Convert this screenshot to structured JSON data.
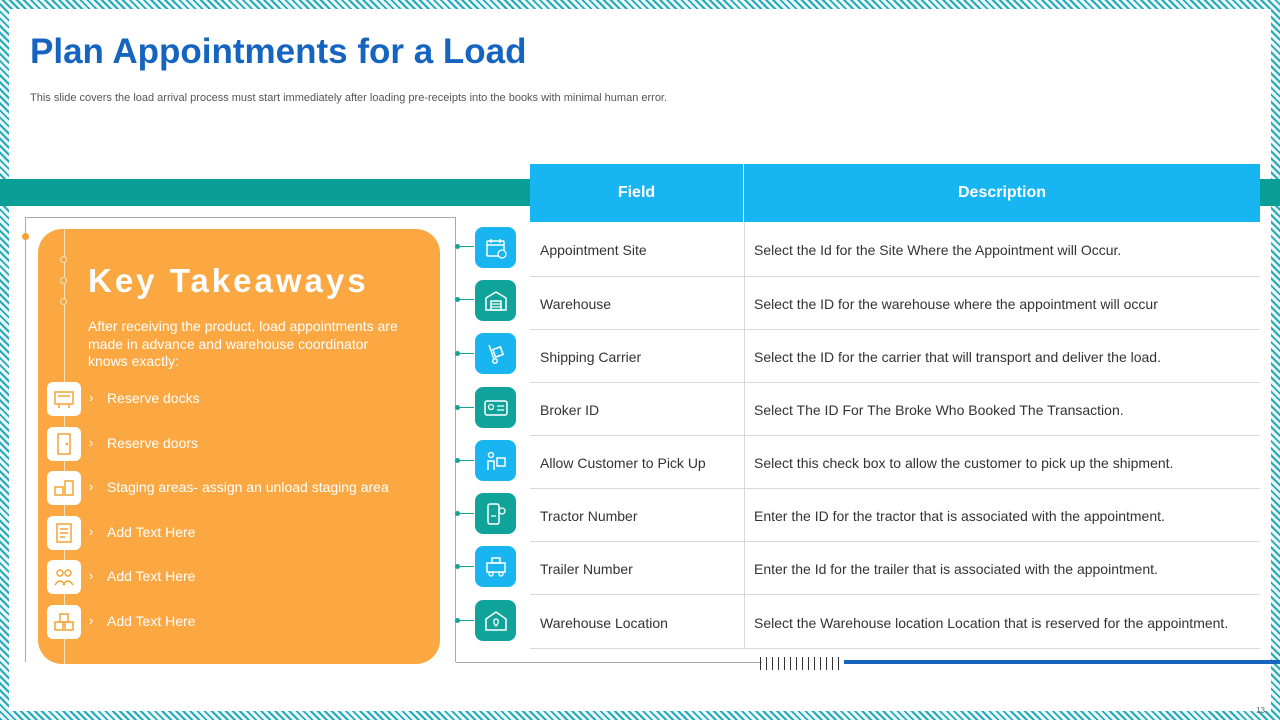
{
  "slide": {
    "title": "Plan Appointments for a Load",
    "subtitle": "This slide covers the load arrival process must start immediately after  loading pre-receipts into the books with minimal human error.",
    "page_number": "13",
    "colors": {
      "title": "#1565c0",
      "accent_orange": "#fba843",
      "teal": "#0a9f96",
      "blue": "#17b5f1"
    }
  },
  "takeaways": {
    "heading": "Key Takeaways",
    "intro": "After receiving the product, load appointments are made in advance and warehouse coordinator knows exactly:",
    "items": [
      {
        "label": "Reserve docks",
        "icon": "dock-icon"
      },
      {
        "label": "Reserve doors",
        "icon": "door-icon"
      },
      {
        "label": "Staging areas- assign an unload staging area",
        "icon": "staging-icon"
      },
      {
        "label": "Add Text Here",
        "icon": "document-icon"
      },
      {
        "label": "Add Text Here",
        "icon": "people-icon"
      },
      {
        "label": "Add Text Here",
        "icon": "boxes-icon"
      }
    ]
  },
  "table": {
    "headers": {
      "field": "Field",
      "description": "Description"
    },
    "rows": [
      {
        "field": "Appointment Site",
        "description": "Select the Id  for the Site Where the Appointment will  Occur.",
        "icon": "calendar-icon"
      },
      {
        "field": "Warehouse",
        "description": "Select the ID  for the warehouse where the appointment will occur",
        "icon": "warehouse-icon"
      },
      {
        "field": "Shipping Carrier",
        "description": "Select the ID  for the carrier that will  transport and deliver the load.",
        "icon": "hand-truck-icon"
      },
      {
        "field": "Broker ID",
        "description": "Select The ID  For The Broke Who Booked The Transaction.",
        "icon": "id-card-icon"
      },
      {
        "field": "Allow Customer to Pick Up",
        "description": "Select this check box to allow  the customer to pick up the shipment.",
        "icon": "customer-pickup-icon"
      },
      {
        "field": "Tractor Number",
        "description": "Enter the ID for the tractor that is associated with the appointment.",
        "icon": "mobile-tracking-icon"
      },
      {
        "field": "Trailer Number",
        "description": "Enter the Id for the trailer that is associated with  the appointment.",
        "icon": "trailer-icon"
      },
      {
        "field": "Warehouse Location",
        "description": "Select the Warehouse location Location that is reserved for the appointment.",
        "icon": "warehouse-location-icon"
      }
    ]
  }
}
